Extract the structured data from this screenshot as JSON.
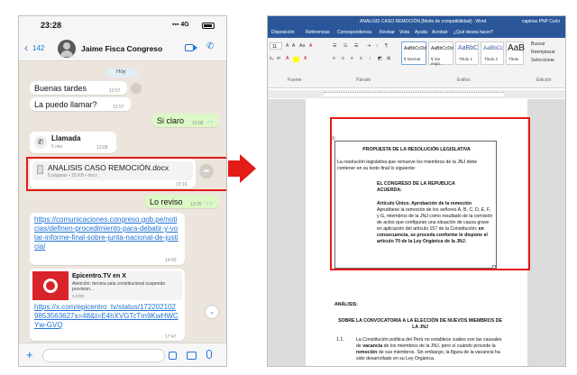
{
  "whatsapp": {
    "status_time": "23:28",
    "status_icons": "▪▪▪ 4G",
    "back_count": "142",
    "contact_name": "Jaime  Fisca Congreso",
    "date_chip": "Hoy",
    "messages": [
      {
        "text": "Buenas tardes",
        "time": "12:57"
      },
      {
        "text": "La puedo llamar?",
        "time": "12:57"
      },
      {
        "text": "Si claro",
        "time": "13:08"
      },
      {
        "call_title": "Llamada",
        "call_sub": "5 min",
        "time": "13:09"
      },
      {
        "file_name": "ANALISIS CASO REMOCIÓN.docx",
        "file_meta": "5 páginas • 25 KB • docx",
        "time": "13:16"
      },
      {
        "text": "Lo reviso",
        "time": "13:25"
      },
      {
        "link_url": "https://comunicaciones.congreso.gob.pe/noticias/definen-procedimiento-para-debatir-y-votar-informe-final-sobre-junta-nacional-de-justicia/",
        "time": "14:02"
      },
      {
        "preview_title": "Epicentro.TV en X",
        "preview_desc": "Atención: tercera sala constitucional suspende provision...",
        "preview_domain": "x.com",
        "link_url": "https://x.com/epicentro_tv/status/1722021029853563627s=48&t=E4hXVGTcTm9KwHWCYw-GVQ",
        "time": "17:47"
      }
    ]
  },
  "word": {
    "title": "ANALISIS CASO REMOCIÓN [Modo de compatibilidad] - Word",
    "user": "capirias PNP Curlo",
    "menu": [
      "Disposición",
      "Referencias",
      "Correspondencia",
      "Revisar",
      "Vista",
      "Ayuda",
      "Acrobat",
      "¿Qué desea hacer?"
    ],
    "font_size": "11",
    "styles": [
      {
        "preview": "AaBbCcDd",
        "label": "¶ Normal"
      },
      {
        "preview": "AaBbCcDd",
        "label": "¶ Sin espa..."
      },
      {
        "preview": "AaBbC",
        "label": "Título 1"
      },
      {
        "preview": "AaBbCc",
        "label": "Título 2"
      },
      {
        "preview": "AaB",
        "label": "Título"
      }
    ],
    "edit_actions": [
      "Buscar",
      "Reemplazar",
      "Seleccionar"
    ],
    "group_labels": [
      "Fuente",
      "Párrafo",
      "Estilos",
      "Edición"
    ],
    "doc": {
      "heading": "PROPUESTA DE LA RESOLUCIÓN LEGISLATIVA",
      "intro": "La resolución legislativa que remueve los miembros de la JNJ debe contener en su texto final lo siguiente:",
      "congress_1": "EL CONGRESO DE LA REPUBLICA",
      "congress_2": "ACUERDA:",
      "article": "Artículo Único.  Aprobación de la remoción",
      "article_body": "Apruébese la remoción de los señores A, B, C, D, E, F, y G, miembros de la JNJ como resultado  de la comisión de actos que configuran una situación de causa grave en aplicación del artículo 157 de la Constitución;",
      "article_bold": "en consecuencia, se proceda conforme lo dispone el artículo 70 de la Ley Orgánica de la JNJ.",
      "analysis": "ANÁLISIS:",
      "section_title_1": "SOBRE LA CONVOCATORIA A LA ELECCIÓN DE NUEVOS MIEMBROS DE",
      "section_title_2": "LA JNJ",
      "item_num": "1.1.",
      "item_text": "La Constitución política del Perú no establece cuáles son las causales de",
      "item_bold_1": "vacancia",
      "item_text_2": "de los miembros de la JNJ, pero sí cuándo procede la",
      "item_bold_2": "remoción",
      "item_text_3": "de sus miembros. Sin embargo, la figura de la vacancia ha sido desarrollado en su Ley Orgánica."
    }
  },
  "colors": {
    "whatsapp_bg": "#ece5dd",
    "bubble_out": "#dcf8c6",
    "word_blue": "#2b579a",
    "highlight_red": "#e41b17"
  }
}
